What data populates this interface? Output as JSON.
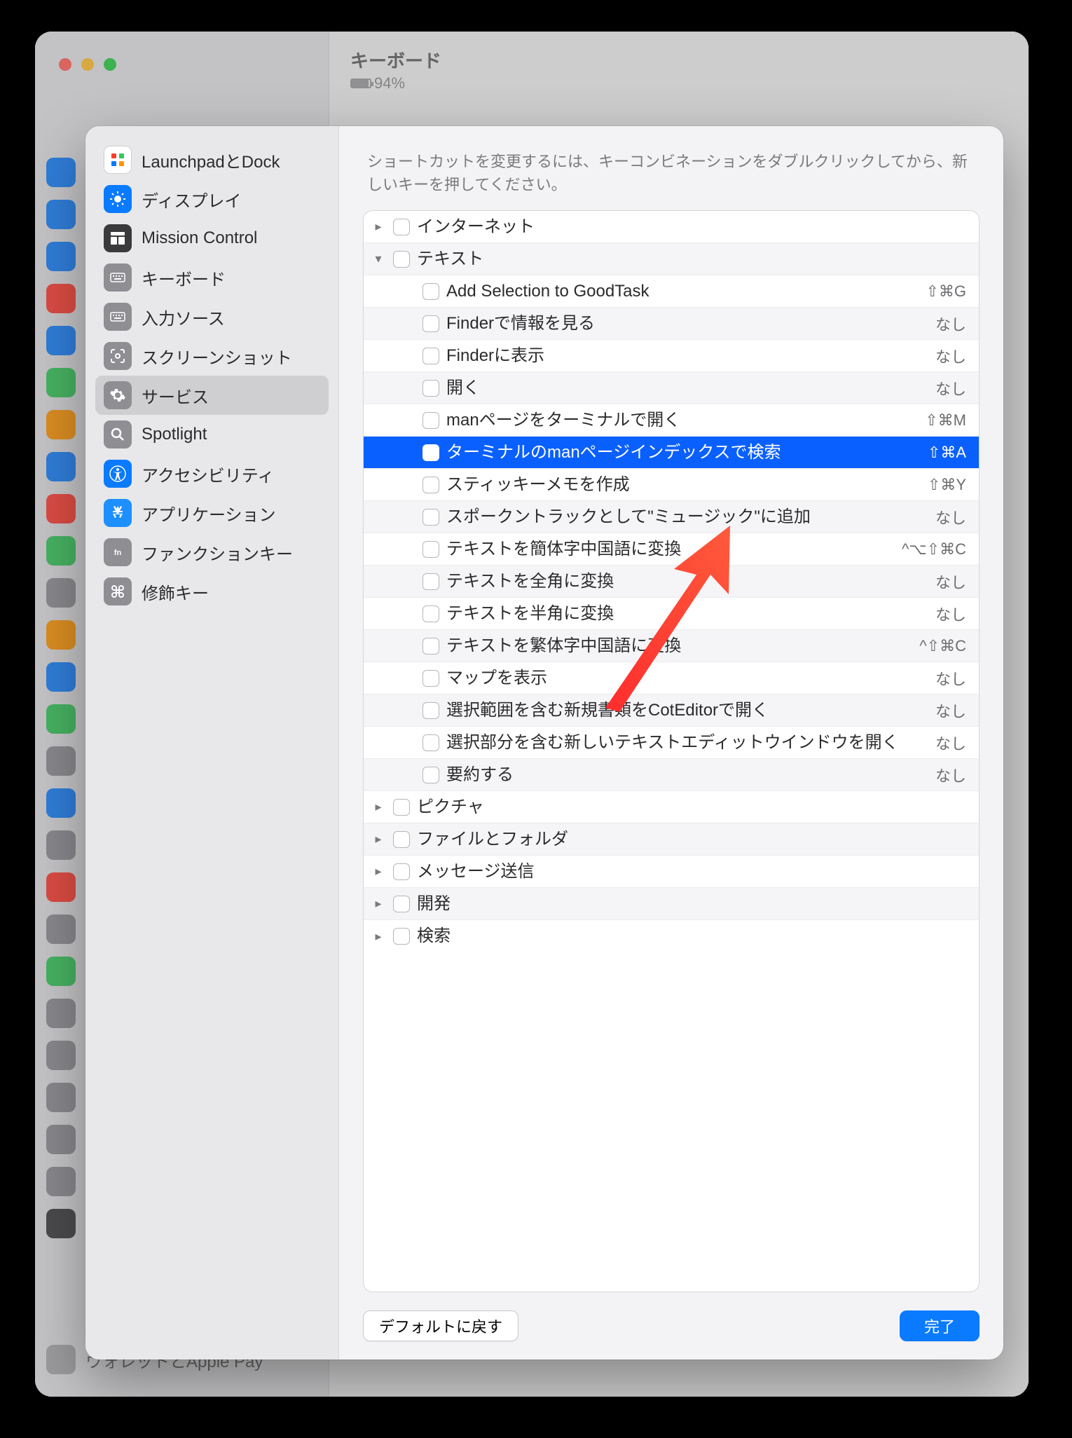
{
  "window": {
    "title": "キーボード",
    "battery_text": "94%",
    "bottom_item": "ウォレットとApple Pay"
  },
  "sheet": {
    "hint": "ショートカットを変更するには、キーコンビネーションをダブルクリックしてから、新しいキーを押してください。",
    "sidebar": [
      {
        "id": "launchpad-dock",
        "label": "LaunchpadとDock",
        "icon": "launchpad"
      },
      {
        "id": "display",
        "label": "ディスプレイ",
        "icon": "display"
      },
      {
        "id": "mission-control",
        "label": "Mission Control",
        "icon": "mission"
      },
      {
        "id": "keyboard",
        "label": "キーボード",
        "icon": "keyboard"
      },
      {
        "id": "input-sources",
        "label": "入力ソース",
        "icon": "keyboard"
      },
      {
        "id": "screenshots",
        "label": "スクリーンショット",
        "icon": "screenshot"
      },
      {
        "id": "services",
        "label": "サービス",
        "icon": "gear",
        "selected": true
      },
      {
        "id": "spotlight",
        "label": "Spotlight",
        "icon": "search"
      },
      {
        "id": "accessibility",
        "label": "アクセシビリティ",
        "icon": "accessibility"
      },
      {
        "id": "applications",
        "label": "アプリケーション",
        "icon": "appstore"
      },
      {
        "id": "function-keys",
        "label": "ファンクションキー",
        "icon": "fn"
      },
      {
        "id": "modifier-keys",
        "label": "修飾キー",
        "icon": "modifier"
      }
    ],
    "groups": [
      {
        "id": "internet",
        "label": "インターネット",
        "expanded": false
      },
      {
        "id": "text",
        "label": "テキスト",
        "expanded": true,
        "items": [
          {
            "id": "goodtask",
            "label": "Add Selection to GoodTask",
            "shortcut": "⇧⌘G"
          },
          {
            "id": "finder-info",
            "label": "Finderで情報を見る",
            "shortcut": "なし"
          },
          {
            "id": "finder-show",
            "label": "Finderに表示",
            "shortcut": "なし"
          },
          {
            "id": "open",
            "label": "開く",
            "shortcut": "なし"
          },
          {
            "id": "man-open",
            "label": "manページをターミナルで開く",
            "shortcut": "⇧⌘M"
          },
          {
            "id": "man-search",
            "label": "ターミナルのmanページインデックスで検索",
            "shortcut": "⇧⌘A",
            "selected": true
          },
          {
            "id": "sticky",
            "label": "スティッキーメモを作成",
            "shortcut": "⇧⌘Y"
          },
          {
            "id": "music-spoken",
            "label": "スポークントラックとして\"ミュージック\"に追加",
            "shortcut": "なし"
          },
          {
            "id": "to-simplified",
            "label": "テキストを簡体字中国語に変換",
            "shortcut": "^⌥⇧⌘C"
          },
          {
            "id": "to-fullwidth",
            "label": "テキストを全角に変換",
            "shortcut": "なし"
          },
          {
            "id": "to-halfwidth",
            "label": "テキストを半角に変換",
            "shortcut": "なし"
          },
          {
            "id": "to-traditional",
            "label": "テキストを繁体字中国語に変換",
            "shortcut": "^⇧⌘C"
          },
          {
            "id": "show-maps",
            "label": "マップを表示",
            "shortcut": "なし"
          },
          {
            "id": "coteditor",
            "label": "選択範囲を含む新規書類をCotEditorで開く",
            "shortcut": "なし"
          },
          {
            "id": "textedit",
            "label": "選択部分を含む新しいテキストエディットウインドウを開く",
            "shortcut": "なし"
          },
          {
            "id": "summarize",
            "label": "要約する",
            "shortcut": "なし"
          }
        ]
      },
      {
        "id": "pictures",
        "label": "ピクチャ",
        "expanded": false
      },
      {
        "id": "files-folders",
        "label": "ファイルとフォルダ",
        "expanded": false
      },
      {
        "id": "messages",
        "label": "メッセージ送信",
        "expanded": false
      },
      {
        "id": "development",
        "label": "開発",
        "expanded": false
      },
      {
        "id": "search",
        "label": "検索",
        "expanded": false
      }
    ],
    "footer": {
      "restore_defaults": "デフォルトに戻す",
      "done": "完了"
    }
  }
}
